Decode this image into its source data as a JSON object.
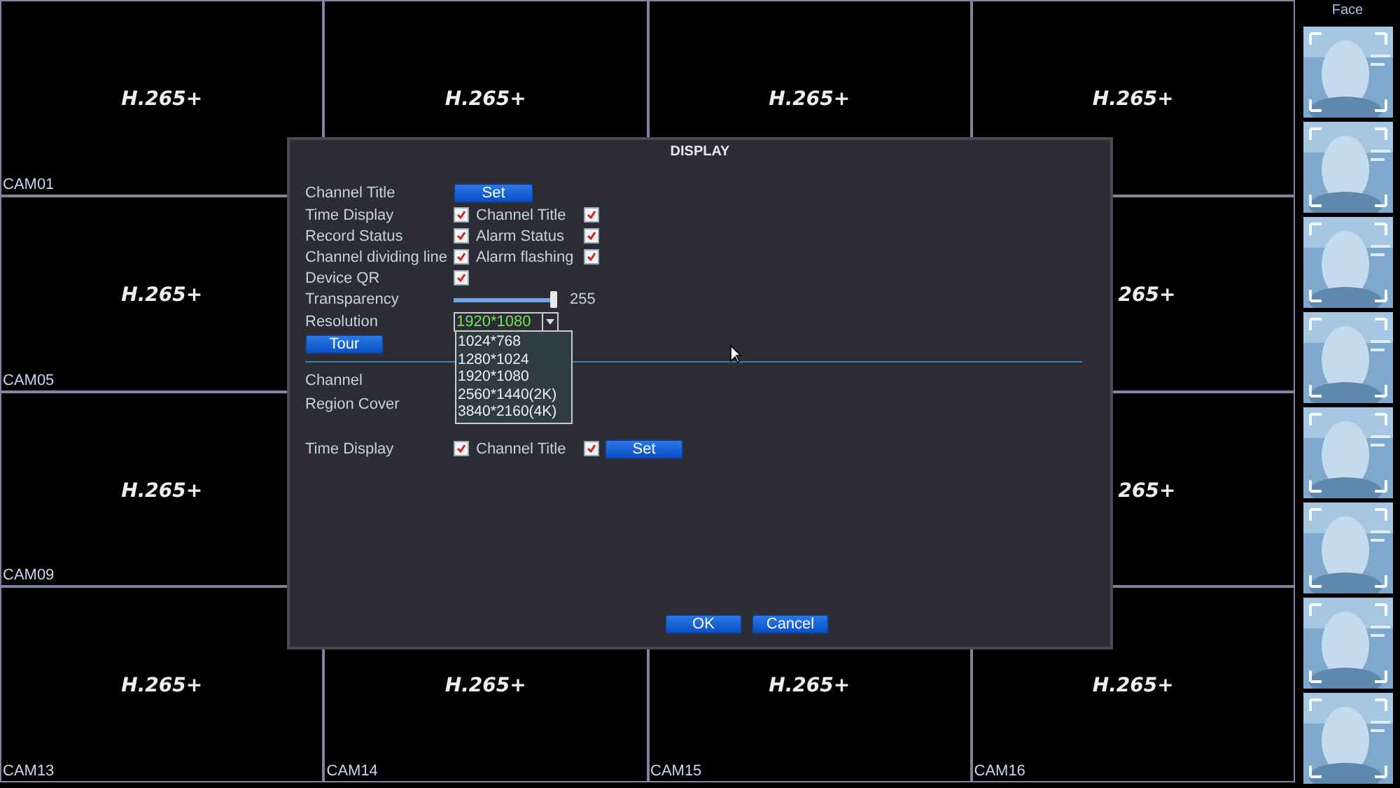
{
  "cells": [
    {
      "label": "CAM01",
      "watermark": "H.265+",
      "kind": "full"
    },
    {
      "watermark": "H.265+",
      "kind": "full"
    },
    {
      "watermark": "H.265+",
      "kind": "full"
    },
    {
      "watermark": "H.265+",
      "kind": "full"
    },
    {
      "label": "CAM05",
      "watermark": "H.265+",
      "kind": "full"
    },
    {
      "kind": "empty"
    },
    {
      "kind": "empty"
    },
    {
      "watermark": "265+",
      "kind": "partial"
    },
    {
      "label": "CAM09",
      "watermark": "H.265+",
      "kind": "full"
    },
    {
      "kind": "empty"
    },
    {
      "kind": "empty"
    },
    {
      "watermark": "265+",
      "kind": "partial"
    },
    {
      "label": "CAM13",
      "watermark": "H.265+",
      "kind": "full"
    },
    {
      "label": "CAM14",
      "watermark": "H.265+",
      "kind": "full"
    },
    {
      "label": "CAM15",
      "watermark": "H.265+",
      "kind": "full"
    },
    {
      "label": "CAM16",
      "watermark": "H.265+",
      "kind": "full"
    }
  ],
  "face_panel": {
    "title": "Face"
  },
  "dialog": {
    "title": "DISPLAY",
    "channel_title": {
      "label": "Channel Title",
      "button": "Set"
    },
    "check_rows": [
      {
        "label": "Time Display",
        "checked": true,
        "label2": "Channel Title",
        "checked2": true
      },
      {
        "label": "Record Status",
        "checked": true,
        "label2": "Alarm Status",
        "checked2": true
      },
      {
        "label": "Channel dividing line",
        "checked": true,
        "label2": "Alarm flashing",
        "checked2": true
      },
      {
        "label": "Device QR",
        "checked": true
      }
    ],
    "transparency": {
      "label": "Transparency",
      "level": 1,
      "reading": "255"
    },
    "resolution": {
      "label": "Resolution",
      "value": "1920*1080",
      "options": [
        "1024*768",
        "1280*1024",
        "1920*1080",
        "2560*1440(2K)",
        "3840*2160(4K)"
      ]
    },
    "tour_button": "Tour",
    "channel_label": "Channel",
    "region_cover_label": "Region Cover",
    "bottom_row": {
      "label": "Time Display",
      "checked": true,
      "label2": "Channel Title",
      "checked2": true,
      "button": "Set"
    },
    "buttons": [
      "OK",
      "Cancel"
    ]
  }
}
